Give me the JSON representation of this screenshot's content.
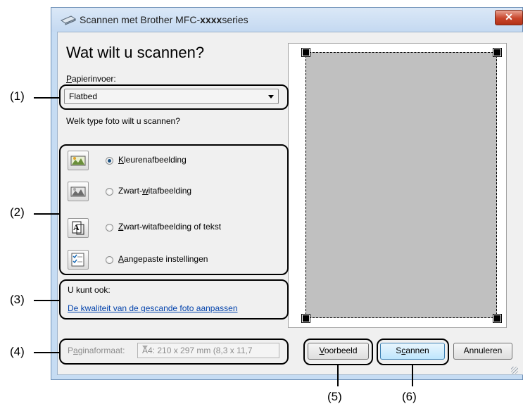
{
  "window": {
    "title_prefix": "Scannen met Brother MFC-",
    "title_bold": "xxxx",
    "title_suffix": "series",
    "close_label": "✕"
  },
  "dialog": {
    "heading": "Wat wilt u scannen?",
    "paper_source": {
      "label_hotkey": "P",
      "label_rest": "apierinvoer:",
      "selected": "Flatbed"
    },
    "photo_question": "Welk type foto wilt u scannen?",
    "scan_types": [
      {
        "icon": "color-photo-icon",
        "label_hotkey": "K",
        "label_rest": "leurenafbeelding",
        "selected": true
      },
      {
        "icon": "grayscale-photo-icon",
        "label_pre": "Zwart-",
        "label_hotkey": "w",
        "label_rest": "itafbeelding",
        "selected": false
      },
      {
        "icon": "text-document-icon",
        "label_hotkey": "Z",
        "label_rest": "wart-witafbeelding of tekst",
        "selected": false
      },
      {
        "icon": "custom-settings-icon",
        "label_hotkey": "A",
        "label_rest": "angepaste instellingen",
        "selected": false
      }
    ],
    "also": {
      "label": "U kunt ook:",
      "link": "De kwaliteit van de gescande foto aanpassen"
    },
    "page_size": {
      "label_hotkey": "a",
      "label_pre": "P",
      "label_rest": "ginaformaat:",
      "value": "A4: 210 x 297 mm (8,3 x 11,7"
    },
    "buttons": {
      "preview_hotkey": "V",
      "preview_rest": "oorbeeld",
      "scan_pre": "S",
      "scan_hotkey": "c",
      "scan_rest": "annen",
      "cancel": "Annuleren"
    }
  },
  "callouts": [
    "(1)",
    "(2)",
    "(3)",
    "(4)",
    "(5)",
    "(6)"
  ]
}
